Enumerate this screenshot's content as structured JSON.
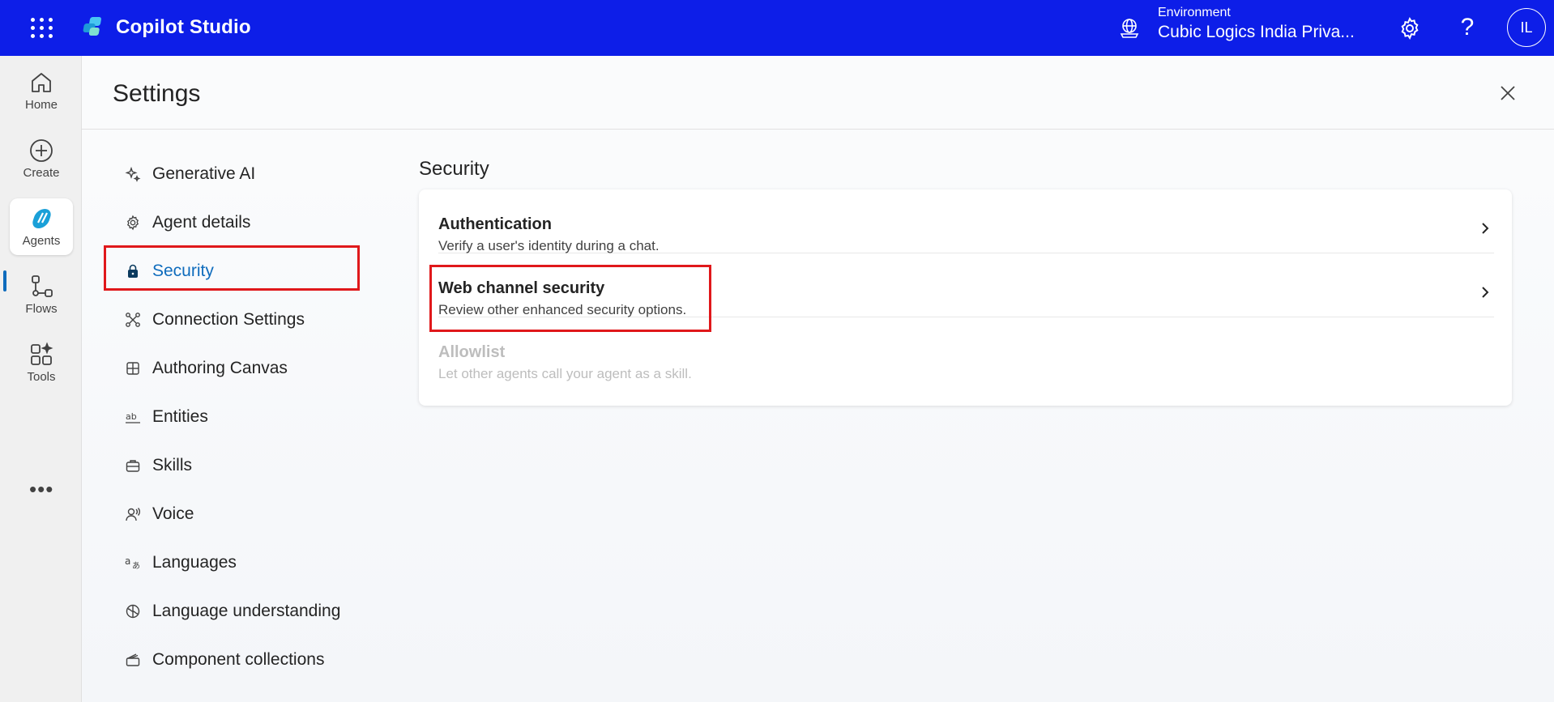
{
  "app": {
    "title": "Copilot Studio",
    "environment_label": "Environment",
    "environment_value": "Cubic Logics India Priva...",
    "avatar_initials": "IL",
    "help_label": "?"
  },
  "rail": {
    "items": [
      {
        "label": "Home",
        "icon": "home-icon"
      },
      {
        "label": "Create",
        "icon": "plus-circle-icon"
      },
      {
        "label": "Agents",
        "icon": "agents-logo-icon"
      },
      {
        "label": "Flows",
        "icon": "flows-icon"
      },
      {
        "label": "Tools",
        "icon": "tools-icon"
      }
    ],
    "more_label": "•••"
  },
  "settings": {
    "title": "Settings",
    "nav": [
      {
        "label": "Generative AI",
        "icon": "sparkle-icon"
      },
      {
        "label": "Agent details",
        "icon": "gear-icon"
      },
      {
        "label": "Security",
        "icon": "lock-icon"
      },
      {
        "label": "Connection Settings",
        "icon": "connection-icon"
      },
      {
        "label": "Authoring Canvas",
        "icon": "grid-icon"
      },
      {
        "label": "Entities",
        "icon": "text-ab-icon"
      },
      {
        "label": "Skills",
        "icon": "briefcase-icon"
      },
      {
        "label": "Voice",
        "icon": "voice-icon"
      },
      {
        "label": "Languages",
        "icon": "translate-icon"
      },
      {
        "label": "Language understanding",
        "icon": "brain-icon"
      },
      {
        "label": "Component collections",
        "icon": "collection-icon"
      }
    ],
    "active": "Security"
  },
  "security": {
    "title": "Security",
    "rows": [
      {
        "title": "Authentication",
        "desc": "Verify a user's identity during a chat.",
        "enabled": true
      },
      {
        "title": "Web channel security",
        "desc": "Review other enhanced security options.",
        "enabled": true
      },
      {
        "title": "Allowlist",
        "desc": "Let other agents call your agent as a skill.",
        "enabled": false
      }
    ]
  },
  "colors": {
    "topbar": "#0d1ee8",
    "accent": "#0f6cbd",
    "highlight": "#e0181b"
  }
}
